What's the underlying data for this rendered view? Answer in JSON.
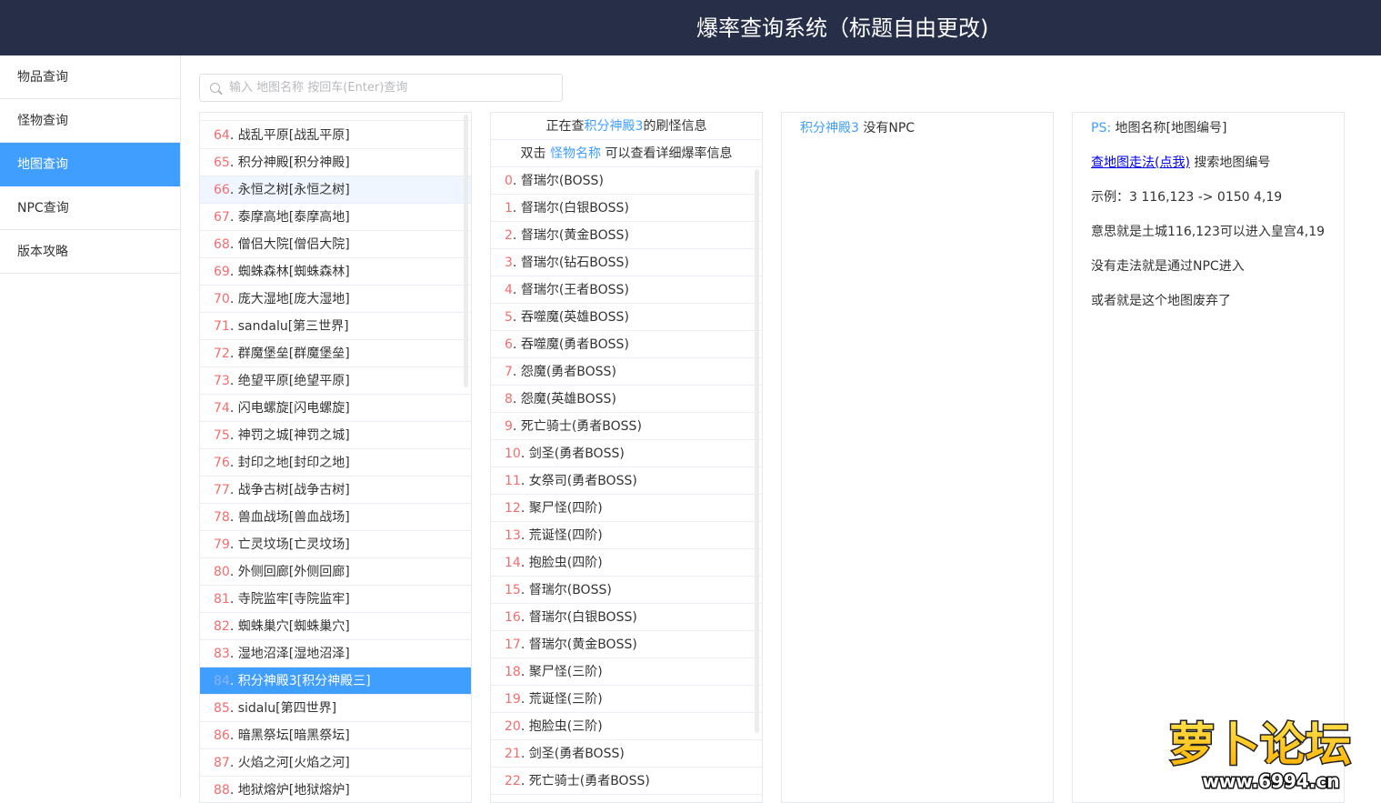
{
  "header": {
    "title": "爆率查询系统（标题自由更改)"
  },
  "sidebar": {
    "items": [
      {
        "label": "物品查询",
        "active": false
      },
      {
        "label": "怪物查询",
        "active": false
      },
      {
        "label": "地图查询",
        "active": true
      },
      {
        "label": "NPC查询",
        "active": false
      },
      {
        "label": "版本攻略",
        "active": false
      }
    ]
  },
  "search": {
    "placeholder": "输入 地图名称 按回车(Enter)查询",
    "value": ""
  },
  "map_list": {
    "selected_index": 20,
    "hover_index": 2,
    "rows": [
      {
        "num": "64",
        "name": "战乱平原[战乱平原]"
      },
      {
        "num": "65",
        "name": "积分神殿[积分神殿]"
      },
      {
        "num": "66",
        "name": "永恒之树[永恒之树]"
      },
      {
        "num": "67",
        "name": "泰摩高地[泰摩高地]"
      },
      {
        "num": "68",
        "name": "僧侣大院[僧侣大院]"
      },
      {
        "num": "69",
        "name": "蜘蛛森林[蜘蛛森林]"
      },
      {
        "num": "70",
        "name": "庞大湿地[庞大湿地]"
      },
      {
        "num": "71",
        "name": "sandalu[第三世界]"
      },
      {
        "num": "72",
        "name": "群魔堡垒[群魔堡垒]"
      },
      {
        "num": "73",
        "name": "绝望平原[绝望平原]"
      },
      {
        "num": "74",
        "name": "闪电螺旋[闪电螺旋]"
      },
      {
        "num": "75",
        "name": "神罚之城[神罚之城]"
      },
      {
        "num": "76",
        "name": "封印之地[封印之地]"
      },
      {
        "num": "77",
        "name": "战争古树[战争古树]"
      },
      {
        "num": "78",
        "name": "兽血战场[兽血战场]"
      },
      {
        "num": "79",
        "name": "亡灵坟场[亡灵坟场]"
      },
      {
        "num": "80",
        "name": "外侧回廊[外侧回廊]"
      },
      {
        "num": "81",
        "name": "寺院监牢[寺院监牢]"
      },
      {
        "num": "82",
        "name": "蜘蛛巢穴[蜘蛛巢穴]"
      },
      {
        "num": "83",
        "name": "湿地沼泽[湿地沼泽]"
      },
      {
        "num": "84",
        "name": "积分神殿3[积分神殿三]"
      },
      {
        "num": "85",
        "name": "sidalu[第四世界]"
      },
      {
        "num": "86",
        "name": "暗黑祭坛[暗黑祭坛]"
      },
      {
        "num": "87",
        "name": "火焰之河[火焰之河]"
      },
      {
        "num": "88",
        "name": "地狱熔炉[地狱熔炉]"
      }
    ]
  },
  "monster_panel": {
    "head1_prefix": "正在查",
    "head1_map": "积分神殿3",
    "head1_suffix": "的刷怪信息",
    "head2_prefix": "双击 ",
    "head2_link": "怪物名称",
    "head2_suffix": " 可以查看详细爆率信息",
    "rows": [
      {
        "num": "0",
        "name": "督瑞尔(BOSS)"
      },
      {
        "num": "1",
        "name": "督瑞尔(白银BOSS)"
      },
      {
        "num": "2",
        "name": "督瑞尔(黄金BOSS)"
      },
      {
        "num": "3",
        "name": "督瑞尔(钻石BOSS)"
      },
      {
        "num": "4",
        "name": "督瑞尔(王者BOSS)"
      },
      {
        "num": "5",
        "name": "吞噬魔(英雄BOSS)"
      },
      {
        "num": "6",
        "name": "吞噬魔(勇者BOSS)"
      },
      {
        "num": "7",
        "name": "怨魔(勇者BOSS)"
      },
      {
        "num": "8",
        "name": "怨魔(英雄BOSS)"
      },
      {
        "num": "9",
        "name": "死亡骑士(勇者BOSS)"
      },
      {
        "num": "10",
        "name": "剑圣(勇者BOSS)"
      },
      {
        "num": "11",
        "name": "女祭司(勇者BOSS)"
      },
      {
        "num": "12",
        "name": "聚尸怪(四阶)"
      },
      {
        "num": "13",
        "name": "荒诞怪(四阶)"
      },
      {
        "num": "14",
        "name": "抱脸虫(四阶)"
      },
      {
        "num": "15",
        "name": "督瑞尔(BOSS)"
      },
      {
        "num": "16",
        "name": "督瑞尔(白银BOSS)"
      },
      {
        "num": "17",
        "name": "督瑞尔(黄金BOSS)"
      },
      {
        "num": "18",
        "name": "聚尸怪(三阶)"
      },
      {
        "num": "19",
        "name": "荒诞怪(三阶)"
      },
      {
        "num": "20",
        "name": "抱脸虫(三阶)"
      },
      {
        "num": "21",
        "name": "剑圣(勇者BOSS)"
      },
      {
        "num": "22",
        "name": "死亡骑士(勇者BOSS)"
      }
    ]
  },
  "npc_panel": {
    "map": "积分神殿3",
    "text": " 没有NPC"
  },
  "info_panel": {
    "ps_label": "PS:",
    "ps_text": " 地图名称[地图编号]",
    "link_text": "查地图走法(点我)",
    "link_suffix": " 搜索地图编号",
    "example": "示例：3 116,123 -> 0150 4,19",
    "meaning": "意思就是土城116,123可以进入皇宫4,19",
    "no_route": "没有走法就是通过NPC进入",
    "abandoned": "或者就是这个地图废弃了"
  },
  "watermark": {
    "logo_text": "萝卜论坛",
    "url": "www.6994.cn"
  },
  "colors": {
    "header_bg": "#262e48",
    "accent": "#409eff",
    "number": "#f56c6c"
  }
}
